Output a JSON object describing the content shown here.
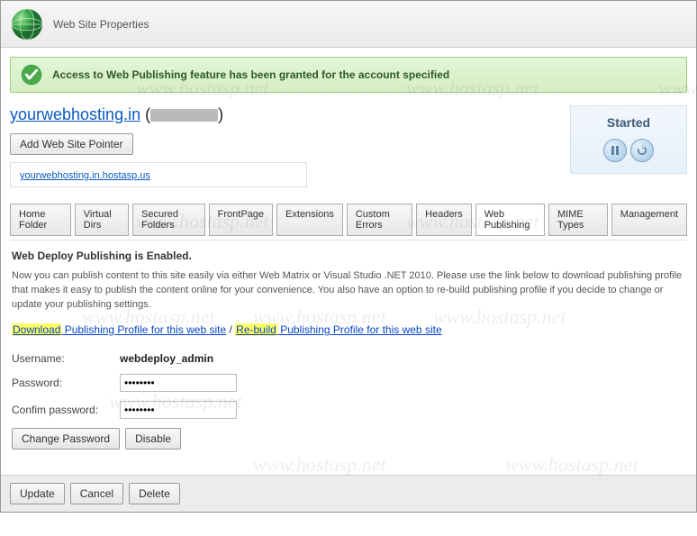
{
  "window": {
    "title": "Web Site Properties"
  },
  "alert": {
    "message": "Access to Web Publishing feature has been granted for the account specified"
  },
  "domain": {
    "name": "yourwebhosting.in",
    "pointer_button": "Add Web Site Pointer",
    "pointer_link": "yourwebhosting.in.hostasp.us"
  },
  "status": {
    "label": "Started"
  },
  "tabs": [
    {
      "label": "Home Folder"
    },
    {
      "label": "Virtual Dirs"
    },
    {
      "label": "Secured Folders"
    },
    {
      "label": "FrontPage"
    },
    {
      "label": "Extensions"
    },
    {
      "label": "Custom Errors"
    },
    {
      "label": "Headers"
    },
    {
      "label": "Web Publishing"
    },
    {
      "label": "MIME Types"
    },
    {
      "label": "Management"
    }
  ],
  "panel": {
    "heading": "Web Deploy Publishing is Enabled.",
    "body": "Now you can publish content to this site easily via either Web Matrix or Visual Studio .NET 2010. Please use the link below to download publishing profile that makes it easy to publish the content online for your convenience. You also have an option to re-build publishing profile if you decide to change or update your publishing settings.",
    "download_hl": "Download",
    "download_rest": " Publishing Profile for this web site",
    "sep": " / ",
    "rebuild_hl": "Re-build",
    "rebuild_rest": " Publishing Profile for this web site",
    "username_label": "Username:",
    "username_value": "webdeploy_admin",
    "password_label": "Password:",
    "password_value": "••••••••",
    "confirm_label": "Confim password:",
    "confirm_value": "••••••••",
    "change_password": "Change Password",
    "disable": "Disable"
  },
  "footer": {
    "update": "Update",
    "cancel": "Cancel",
    "delete": "Delete"
  },
  "watermark": "www.hostasp.net"
}
